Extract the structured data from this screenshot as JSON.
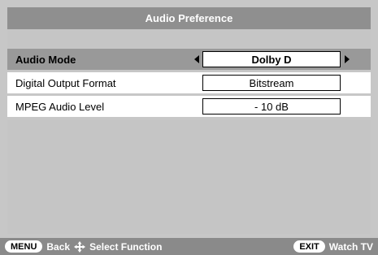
{
  "header": {
    "title": "Audio Preference"
  },
  "rows": [
    {
      "label": "Audio Mode",
      "value": "Dolby D",
      "selected": true
    },
    {
      "label": "Digital Output Format",
      "value": "Bitstream",
      "selected": false
    },
    {
      "label": "MPEG Audio Level",
      "value": "- 10 dB",
      "selected": false
    }
  ],
  "footer": {
    "menu_key": "MENU",
    "back_label": "Back",
    "select_label": "Select Function",
    "exit_key": "EXIT",
    "watch_label": "Watch TV"
  },
  "icons": {
    "select": "dpad-arrows-icon",
    "left_arrow": "arrow-left-icon",
    "right_arrow": "arrow-right-icon"
  }
}
